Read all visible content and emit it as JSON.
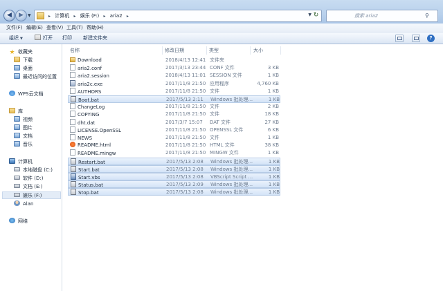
{
  "nav_buttons": {
    "back": "◀",
    "forward": "▶"
  },
  "address": {
    "crumbs": [
      "计算机",
      "娱乐 (F:)",
      "aria2"
    ],
    "refresh": "↻"
  },
  "search": {
    "placeholder": "搜索 aria2"
  },
  "menu": [
    "文件(F)",
    "编辑(E)",
    "查看(V)",
    "工具(T)",
    "帮助(H)"
  ],
  "toolbar": {
    "organize": "组织",
    "open": "打开",
    "print": "打印",
    "new_folder": "新建文件夹",
    "help": "?"
  },
  "sidebar": {
    "favorites": {
      "label": "收藏夹",
      "items": [
        "下载",
        "桌面",
        "最近访问的位置"
      ]
    },
    "wps_cloud": "WPS云文档",
    "libraries": {
      "label": "库",
      "items": [
        "视频",
        "图片",
        "文档",
        "音乐"
      ]
    },
    "computer": {
      "label": "计算机",
      "items": [
        "本地磁盘 (C:)",
        "软件 (D:)",
        "文档 (E:)",
        "娱乐 (F:)",
        "Alan"
      ],
      "selected": "娱乐 (F:)"
    },
    "network": "网络"
  },
  "columns": {
    "name": "名称",
    "date": "修改日期",
    "type": "类型",
    "size": "大小"
  },
  "files": [
    {
      "name": "Download",
      "date": "2018/4/13 12:41",
      "type": "文件夹",
      "size": "",
      "icon": "folder-icon",
      "selected": false
    },
    {
      "name": "aria2.conf",
      "date": "2017/3/13 23:44",
      "type": "CONF 文件",
      "size": "3 KB",
      "icon": "file-icon",
      "selected": false
    },
    {
      "name": "aria2.session",
      "date": "2018/4/13 11:01",
      "type": "SESSION 文件",
      "size": "1 KB",
      "icon": "file-icon",
      "selected": false
    },
    {
      "name": "aria2c.exe",
      "date": "2017/11/8 21:50",
      "type": "应用程序",
      "size": "4,760 KB",
      "icon": "exe-icon",
      "selected": false
    },
    {
      "name": "AUTHORS",
      "date": "2017/11/8 21:50",
      "type": "文件",
      "size": "1 KB",
      "icon": "file-icon",
      "selected": false
    },
    {
      "name": "Boot.bat",
      "date": "2017/5/13 2:11",
      "type": "Windows 批处理...",
      "size": "1 KB",
      "icon": "bat-icon",
      "selected": true
    },
    {
      "name": "ChangeLog",
      "date": "2017/11/8 21:50",
      "type": "文件",
      "size": "2 KB",
      "icon": "file-icon",
      "selected": false
    },
    {
      "name": "COPYING",
      "date": "2017/11/8 21:50",
      "type": "文件",
      "size": "18 KB",
      "icon": "file-icon",
      "selected": false
    },
    {
      "name": "dht.dat",
      "date": "2017/3/7 15:07",
      "type": "DAT 文件",
      "size": "27 KB",
      "icon": "dat-icon",
      "selected": false
    },
    {
      "name": "LICENSE.OpenSSL",
      "date": "2017/11/8 21:50",
      "type": "OPENSSL 文件",
      "size": "6 KB",
      "icon": "file-icon",
      "selected": false
    },
    {
      "name": "NEWS",
      "date": "2017/11/8 21:50",
      "type": "文件",
      "size": "1 KB",
      "icon": "file-icon",
      "selected": false
    },
    {
      "name": "README.html",
      "date": "2017/11/8 21:50",
      "type": "HTML 文件",
      "size": "38 KB",
      "icon": "html-icon",
      "selected": false
    },
    {
      "name": "README.mingw",
      "date": "2017/11/8 21:50",
      "type": "MINGW 文件",
      "size": "1 KB",
      "icon": "file-icon",
      "selected": false
    },
    {
      "name": "Restart.bat",
      "date": "2017/5/13 2:08",
      "type": "Windows 批处理...",
      "size": "1 KB",
      "icon": "bat-icon",
      "selected": true
    },
    {
      "name": "Start.bat",
      "date": "2017/5/13 2:08",
      "type": "Windows 批处理...",
      "size": "1 KB",
      "icon": "bat-icon",
      "selected": true
    },
    {
      "name": "Start.vbs",
      "date": "2017/5/13 2:08",
      "type": "VBScript Script ...",
      "size": "1 KB",
      "icon": "vbs-icon",
      "selected": true
    },
    {
      "name": "Status.bat",
      "date": "2017/5/13 2:09",
      "type": "Windows 批处理...",
      "size": "1 KB",
      "icon": "bat-icon",
      "selected": true
    },
    {
      "name": "Stop.bat",
      "date": "2017/5/13 2:08",
      "type": "Windows 批处理...",
      "size": "1 KB",
      "icon": "bat-icon",
      "selected": true
    }
  ]
}
